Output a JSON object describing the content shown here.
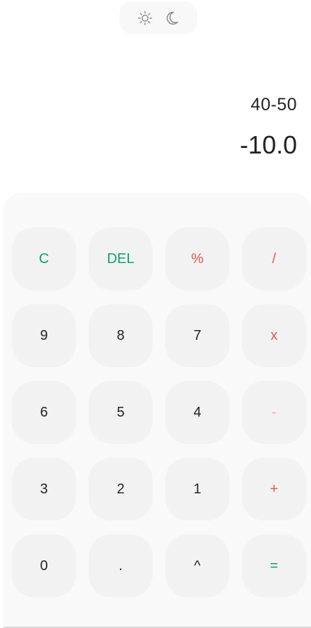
{
  "theme_toggle": {
    "light_icon": "sun-icon",
    "dark_icon": "moon-icon"
  },
  "display": {
    "expression": "40-50",
    "result": "-10.0"
  },
  "keypad": {
    "rows": [
      [
        {
          "label": "C",
          "name": "clear-button"
        },
        {
          "label": "DEL",
          "name": "delete-button"
        },
        {
          "label": "%",
          "name": "percent-button"
        },
        {
          "label": "/",
          "name": "divide-button"
        }
      ],
      [
        {
          "label": "9",
          "name": "digit-9-button"
        },
        {
          "label": "8",
          "name": "digit-8-button"
        },
        {
          "label": "7",
          "name": "digit-7-button"
        },
        {
          "label": "x",
          "name": "multiply-button"
        }
      ],
      [
        {
          "label": "6",
          "name": "digit-6-button"
        },
        {
          "label": "5",
          "name": "digit-5-button"
        },
        {
          "label": "4",
          "name": "digit-4-button"
        },
        {
          "label": "-",
          "name": "subtract-button"
        }
      ],
      [
        {
          "label": "3",
          "name": "digit-3-button"
        },
        {
          "label": "2",
          "name": "digit-2-button"
        },
        {
          "label": "1",
          "name": "digit-1-button"
        },
        {
          "label": "+",
          "name": "add-button"
        }
      ],
      [
        {
          "label": "0",
          "name": "digit-0-button"
        },
        {
          "label": ".",
          "name": "decimal-button"
        },
        {
          "label": "^",
          "name": "power-button"
        },
        {
          "label": "=",
          "name": "equals-button"
        }
      ]
    ]
  },
  "colors": {
    "accent_green": "#0f9d74",
    "operator_red": "#ea5455",
    "key_background": "#f2f2f2",
    "keypad_background": "#f9f9f9"
  }
}
